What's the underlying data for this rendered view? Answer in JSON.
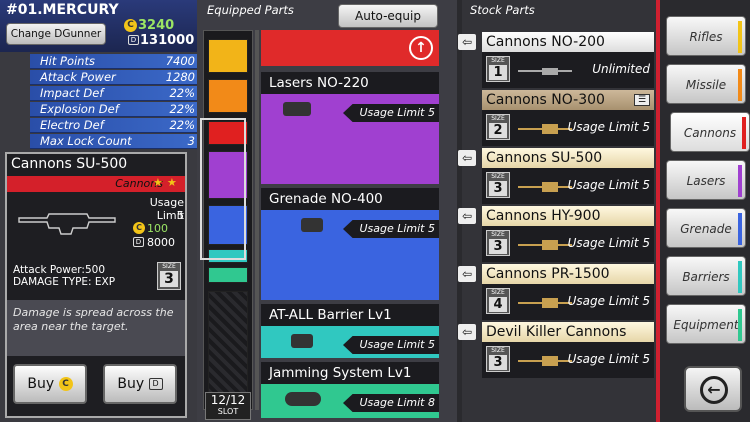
{
  "header": {
    "mech_name": "#01.MERCURY",
    "change_button": "Change DGunner",
    "credits": "3240",
    "gems": "131000",
    "coin_glyph": "C",
    "gem_glyph": "D"
  },
  "stats": [
    {
      "label": "Hit Points",
      "value": "7400"
    },
    {
      "label": "Attack Power",
      "value": "1280"
    },
    {
      "label": "Impact Def",
      "value": "22%"
    },
    {
      "label": "Explosion Def",
      "value": "22%"
    },
    {
      "label": "Electro Def",
      "value": "22%"
    },
    {
      "label": "Max Lock Count",
      "value": "3"
    }
  ],
  "detail": {
    "title": "Cannons SU-500",
    "category": "Cannons",
    "stars": 2,
    "usage_label": "Usage Limit",
    "usage_value": "5",
    "price_credits": "100",
    "price_gems": "8000",
    "attack": "Attack Power:500",
    "damage_type": "DAMAGE TYPE: EXP",
    "size_label": "SIZE",
    "size": "3",
    "description": "Damage is spread across the area near the target.",
    "buy_credits": "Buy",
    "buy_gems": "Buy"
  },
  "equipped": {
    "label": "Equipped Parts",
    "auto_button": "Auto-equip",
    "slot_used": "12",
    "slot_total": "/12",
    "slot_label": "SLOT",
    "items": [
      {
        "name": "Lasers NO-220",
        "usage": "Usage Limit 5",
        "color": "#a040d0"
      },
      {
        "name": "Grenade NO-400",
        "usage": "Usage Limit 5",
        "color": "#3a64e0"
      },
      {
        "name": "AT-ALL Barrier Lv1",
        "usage": "Usage Limit 5",
        "color": "#30c8c0"
      },
      {
        "name": "Jamming System Lv1",
        "usage": "Usage Limit 8",
        "color": "#30c890"
      }
    ]
  },
  "stock": {
    "label": "Stock Parts",
    "items": [
      {
        "name": "Cannons NO-200",
        "size": "1",
        "usage": "Unlimited"
      },
      {
        "name": "Cannons NO-300",
        "size": "2",
        "usage": "Usage Limit 5"
      },
      {
        "name": "Cannons SU-500",
        "size": "3",
        "usage": "Usage Limit 5"
      },
      {
        "name": "Cannons HY-900",
        "size": "3",
        "usage": "Usage Limit 5"
      },
      {
        "name": "Cannons PR-1500",
        "size": "4",
        "usage": "Usage Limit 5"
      },
      {
        "name": "Devil Killer Cannons",
        "size": "3",
        "usage": "Usage Limit 5"
      }
    ]
  },
  "tabs": [
    {
      "label": "Rifles",
      "color": "#f2c418"
    },
    {
      "label": "Missile",
      "color": "#f28a18"
    },
    {
      "label": "Cannons",
      "color": "#e02020"
    },
    {
      "label": "Lasers",
      "color": "#a040d0"
    },
    {
      "label": "Grenade",
      "color": "#3a64e0"
    },
    {
      "label": "Barriers",
      "color": "#30c8c0"
    },
    {
      "label": "Equipment",
      "color": "#30c890"
    }
  ]
}
